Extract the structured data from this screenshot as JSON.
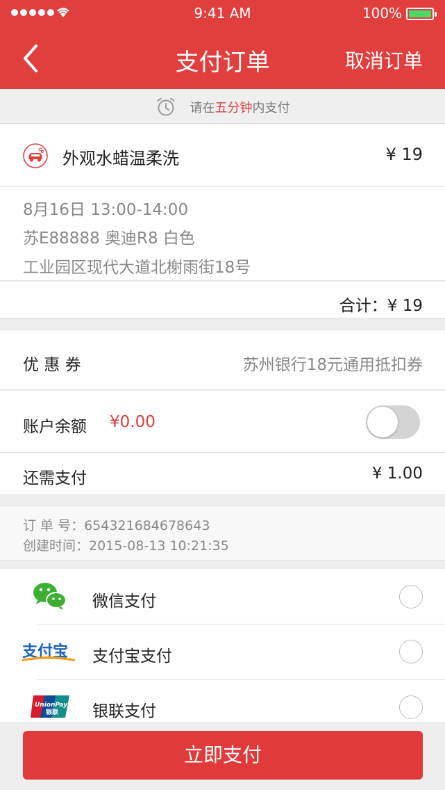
{
  "status_bar": {
    "time": "9:41 AM",
    "battery": "100%"
  },
  "nav": {
    "title": "支付订单",
    "action": "取消订单"
  },
  "notice": {
    "prefix": "请在",
    "highlight": "五分钟",
    "suffix": "内支付"
  },
  "service": {
    "name": "外观水蜡温柔洗",
    "price": "¥ 19"
  },
  "details": {
    "datetime": "8月16日  13:00-14:00",
    "vehicle": "苏E88888  奥迪R8  白色",
    "address": "工业园区现代大道北榭雨街18号"
  },
  "total": {
    "text": "合计：¥ 19"
  },
  "coupon": {
    "label": "优 惠 券",
    "value": "苏州银行18元通用抵扣券"
  },
  "balance": {
    "label": "账户余额",
    "amount": "¥0.00"
  },
  "remaining": {
    "label": "还需支付",
    "value": "¥ 1.00"
  },
  "order_info": {
    "order_no": "订 单 号：654321684678643",
    "created": "创建时间：2015-08-13  10:21:35"
  },
  "payment_methods": [
    {
      "label": "微信支付",
      "icon": "wechat-icon"
    },
    {
      "label": "支付宝支付",
      "icon": "alipay-icon"
    },
    {
      "label": "银联支付",
      "icon": "unionpay-icon"
    }
  ],
  "logos": {
    "alipay": "支付宝",
    "unionpay": "UnionPay",
    "unionpay_cn": "银联"
  },
  "submit": {
    "label": "立即支付"
  },
  "colors": {
    "brand_red": "#e13e3e",
    "button_red": "#e13a3a",
    "toggle_off": "#d4d4d4"
  }
}
